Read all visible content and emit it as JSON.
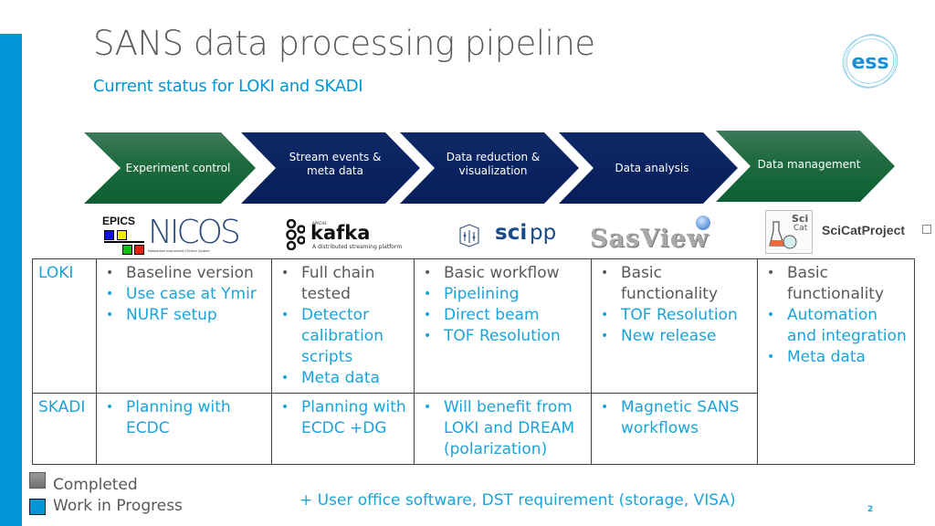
{
  "header": {
    "title": "SANS data processing pipeline",
    "subtitle": "Current status for LOKI and SKADI",
    "logo_text": "ess"
  },
  "pipeline": [
    {
      "label": "Experiment control",
      "lines": [
        "Experiment control"
      ],
      "color": "green"
    },
    {
      "label": "Stream events & meta data",
      "lines": [
        "Stream events &",
        "meta data"
      ],
      "color": "navy"
    },
    {
      "label": "Data reduction & visualization",
      "lines": [
        "Data reduction &",
        "visualization"
      ],
      "color": "navy"
    },
    {
      "label": "Data analysis",
      "lines": [
        "Data analysis"
      ],
      "color": "navy"
    },
    {
      "label": "Data management",
      "lines": [
        "Data management"
      ],
      "color": "green"
    }
  ],
  "logos": {
    "epics": "EPICS",
    "nicos": "NICOS",
    "nicos_caption": "Networked Instrument COntrol System",
    "kafka": "kafka",
    "kafka_apache": "APACHE",
    "kafka_caption": "A distributed streaming platform",
    "scipp_sci": "sci",
    "scipp_pp": "pp",
    "sasview": "SasView",
    "scicat_badge_top": "Sci",
    "scicat_badge_bottom": "Cat",
    "scicat": "SciCatProject"
  },
  "table": {
    "rows": [
      {
        "instrument": "LOKI",
        "cells": [
          [
            {
              "text": "Baseline  version",
              "status": "done"
            },
            {
              "text": "Use case at Ymir",
              "status": "wip"
            },
            {
              "text": "NURF setup",
              "status": "wip"
            }
          ],
          [
            {
              "text": "Full chain tested",
              "status": "done"
            },
            {
              "text": "Detector calibration scripts",
              "status": "wip"
            },
            {
              "text": "Meta data",
              "status": "wip"
            }
          ],
          [
            {
              "text": "Basic workflow",
              "status": "done"
            },
            {
              "text": "Pipelining",
              "status": "wip"
            },
            {
              "text": "Direct beam",
              "status": "wip"
            },
            {
              "text": "TOF Resolution",
              "status": "wip"
            }
          ],
          [
            {
              "text": "Basic functionality",
              "status": "done"
            },
            {
              "text": "TOF Resolution",
              "status": "wip"
            },
            {
              "text": "New release",
              "status": "wip"
            }
          ]
        ]
      },
      {
        "instrument": "SKADI",
        "cells": [
          [
            {
              "text": "Planning with ECDC",
              "status": "wip"
            }
          ],
          [
            {
              "text": "Planning with ECDC +DG",
              "status": "wip"
            }
          ],
          [
            {
              "text": "Will benefit from LOKI and DREAM (polarization)",
              "status": "wip"
            }
          ],
          [
            {
              "text": "Magnetic SANS workflows",
              "status": "wip"
            }
          ]
        ]
      }
    ],
    "shared_cell": [
      {
        "text": "Basic functionality",
        "status": "done"
      },
      {
        "text": "Automation and integration",
        "status": "wip"
      },
      {
        "text": "Meta data",
        "status": "wip"
      }
    ]
  },
  "legend": {
    "completed": "Completed",
    "wip": "Work in Progress"
  },
  "footnote": "+ User office software, DST requirement (storage, VISA)",
  "page_number": "2",
  "colors": {
    "accent_blue": "#0096d6",
    "text_blue": "#1ba3da",
    "text_gray": "#595959",
    "chevron_green": "#1f6b3f",
    "chevron_navy": "#0a2360"
  }
}
